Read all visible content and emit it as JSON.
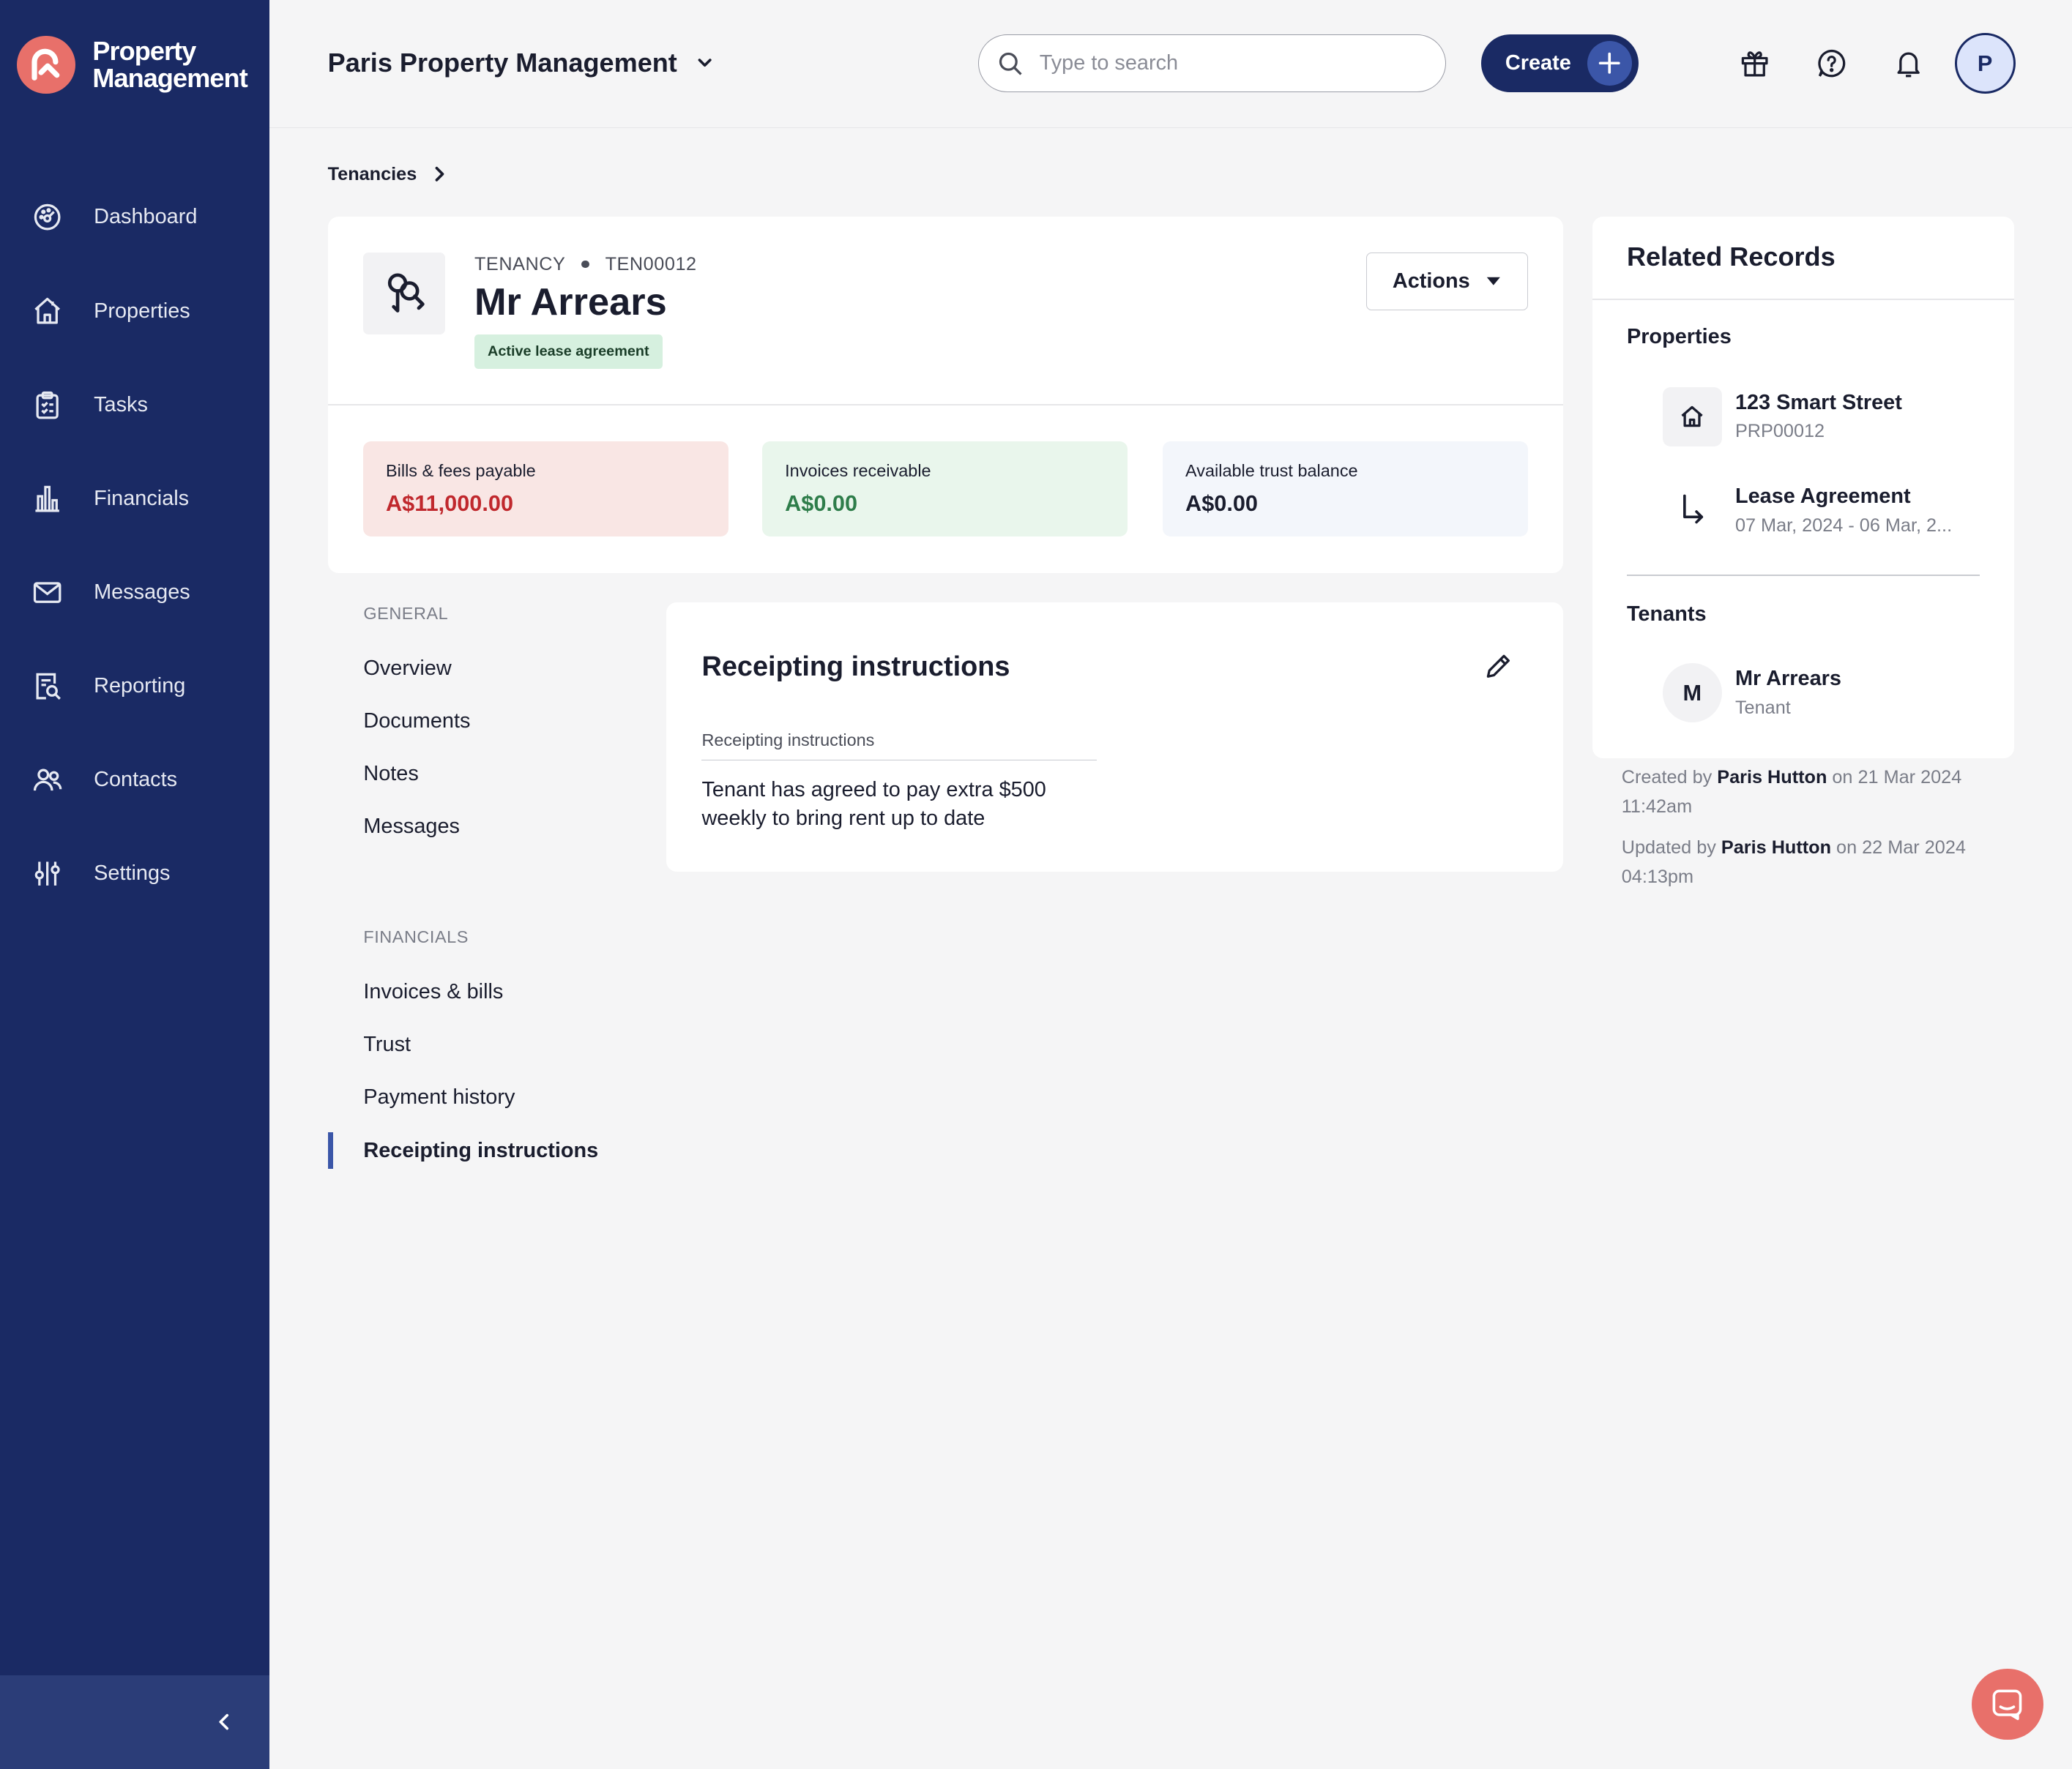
{
  "app": {
    "brand_line1": "Property",
    "brand_line2": "Management",
    "accent": "#1a2a64",
    "brand_color": "#e8706a"
  },
  "topbar": {
    "org_name": "Paris Property Management",
    "search_placeholder": "Type to search",
    "create_label": "Create",
    "avatar_initial": "P",
    "icons": [
      "gift-icon",
      "help-icon",
      "bell-icon"
    ]
  },
  "sidebar": {
    "items": [
      {
        "label": "Dashboard",
        "icon": "dashboard-icon"
      },
      {
        "label": "Properties",
        "icon": "house-icon"
      },
      {
        "label": "Tasks",
        "icon": "clipboard-icon"
      },
      {
        "label": "Financials",
        "icon": "bar-chart-icon"
      },
      {
        "label": "Messages",
        "icon": "mail-icon"
      },
      {
        "label": "Reporting",
        "icon": "report-search-icon"
      },
      {
        "label": "Contacts",
        "icon": "people-icon"
      },
      {
        "label": "Settings",
        "icon": "sliders-icon"
      }
    ]
  },
  "breadcrumb": {
    "root": "Tenancies"
  },
  "header": {
    "type_label": "TENANCY",
    "record_id": "TEN00012",
    "title": "Mr Arrears",
    "status_badge": "Active lease agreement",
    "actions_label": "Actions"
  },
  "stats": [
    {
      "label": "Bills & fees payable",
      "value": "A$11,000.00",
      "color": "#c0282d",
      "bg": "#f9e6e4"
    },
    {
      "label": "Invoices receivable",
      "value": "A$0.00",
      "color": "#2e7d4a",
      "bg": "#e9f6ec"
    },
    {
      "label": "Available trust balance",
      "value": "A$0.00",
      "color": "#1a1d2e",
      "bg": "#f3f6fb"
    }
  ],
  "left_nav": {
    "general_heading": "GENERAL",
    "general": [
      "Overview",
      "Documents",
      "Notes",
      "Messages"
    ],
    "financials_heading": "FINANCIALS",
    "financials": [
      "Invoices & bills",
      "Trust",
      "Payment history",
      "Receipting instructions"
    ]
  },
  "content": {
    "heading": "Receipting instructions",
    "field_label": "Receipting instructions",
    "field_value": "Tenant has agreed to pay extra $500 weekly to bring rent up to date"
  },
  "related": {
    "heading": "Related Records",
    "properties_heading": "Properties",
    "property_name": "123 Smart Street",
    "property_id": "PRP00012",
    "lease_name": "Lease Agreement",
    "lease_dates": "07 Mar, 2024 - 06 Mar, 2...",
    "tenants_heading": "Tenants",
    "tenant_initial": "M",
    "tenant_name": "Mr Arrears",
    "tenant_role": "Tenant"
  },
  "audit": {
    "created_prefix": "Created by",
    "created_by": "Paris Hutton",
    "created_on": "on 21 Mar 2024 11:42am",
    "updated_prefix": "Updated by",
    "updated_by": "Paris Hutton",
    "updated_on": "on 22 Mar 2024 04:13pm"
  }
}
